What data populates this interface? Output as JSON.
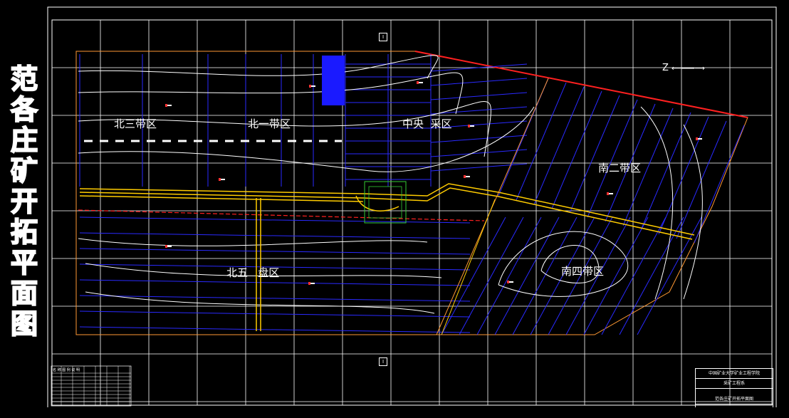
{
  "title_vertical": [
    "范",
    "各",
    "庄",
    "矿",
    "开",
    "拓",
    "平",
    "面",
    "图"
  ],
  "zones": {
    "north3": "北三带区",
    "north1": "北一带区",
    "central": "中央  采区",
    "south2": "南二带区",
    "north5": "北五   盘区",
    "south4": "南四带区"
  },
  "north_arrow": "Z",
  "section_marker_top": "I",
  "section_marker_bottom": "I",
  "title_block": {
    "row1": "中国矿业大学矿业工程学院",
    "row2": "采矿工程系",
    "row3": "范各庄矿开拓平面图"
  },
  "legend_table_header": "名  称  图  例  说  明",
  "colors": {
    "background": "#000000",
    "grid": "#ffffff",
    "roadway": "#ffcc00",
    "fault": "#ff2020",
    "workings": "#2020ff",
    "boundary": "#ff9933",
    "contour": "#ffffff",
    "shaft": "#33cc33"
  }
}
